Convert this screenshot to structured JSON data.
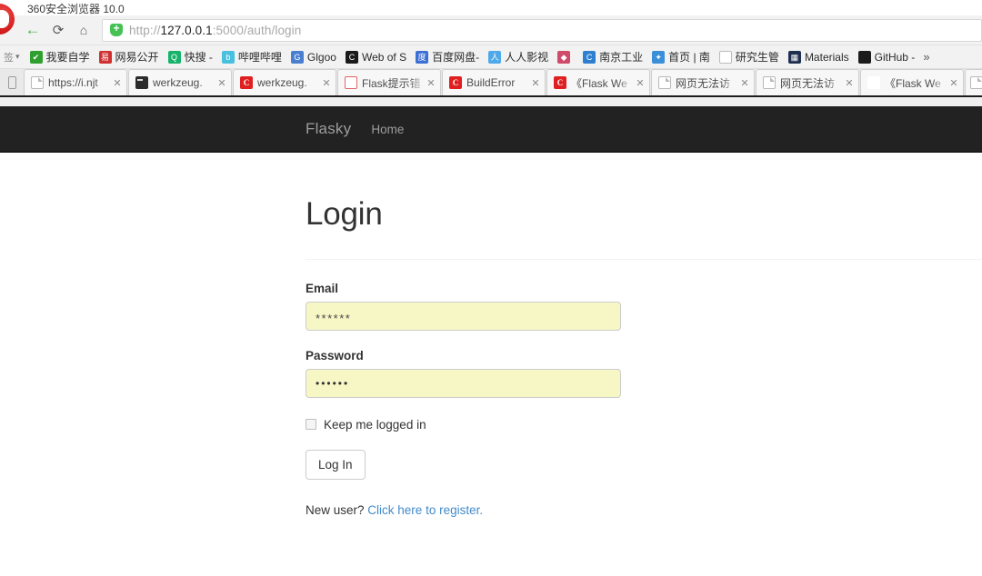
{
  "browser": {
    "window_title": "360安全浏览器 10.0",
    "nav": {
      "back_icon": "arrow-left-icon",
      "reload_icon": "reload-icon",
      "home_icon": "home-icon",
      "back_glyph": "←",
      "reload_glyph": "⟳",
      "home_glyph": "⌂"
    },
    "url": {
      "scheme": "http://",
      "host": "127.0.0.1",
      "rest": ":5000/auth/login",
      "full": "http://127.0.0.1:5000/auth/login",
      "security_icon": "shield-icon"
    },
    "bookmarks": {
      "leading": "签",
      "caret": "▾",
      "more": "»",
      "items": [
        {
          "label": "我要自学",
          "icon": "bookmark-favicon",
          "color": "#2fa02f",
          "glyph": "✔"
        },
        {
          "label": "网易公开",
          "icon": "bookmark-favicon",
          "color": "#d03030",
          "glyph": "易"
        },
        {
          "label": "快搜 -",
          "icon": "bookmark-favicon",
          "color": "#17b36b",
          "glyph": "Q"
        },
        {
          "label": "哔哩哔哩",
          "icon": "bookmark-favicon",
          "color": "#49c0e0",
          "glyph": "b"
        },
        {
          "label": "Glgoo",
          "icon": "bookmark-favicon",
          "color": "#4a7fd0",
          "glyph": "G"
        },
        {
          "label": "Web of S",
          "icon": "bookmark-favicon",
          "color": "#1a1a1a",
          "glyph": "C"
        },
        {
          "label": "百度网盘-",
          "icon": "bookmark-favicon",
          "color": "#3b6fd4",
          "glyph": "度"
        },
        {
          "label": "人人影视",
          "icon": "bookmark-favicon",
          "color": "#4fa8e8",
          "glyph": "人"
        },
        {
          "label": "",
          "icon": "bookmark-favicon",
          "color": "#d04a6a",
          "glyph": "◆"
        },
        {
          "label": "南京工业",
          "icon": "bookmark-favicon",
          "color": "#2f7fd0",
          "glyph": "C"
        },
        {
          "label": "首页 | 南",
          "icon": "bookmark-favicon",
          "color": "#3b8fd9",
          "glyph": "✦"
        },
        {
          "label": "研究生管",
          "icon": "bookmark-favicon",
          "color": "#ffffff",
          "glyph": ""
        },
        {
          "label": "Materials",
          "icon": "bookmark-favicon",
          "color": "#1f2f4f",
          "glyph": "▦"
        },
        {
          "label": "GitHub -",
          "icon": "bookmark-favicon",
          "color": "#1b1b1b",
          "glyph": ""
        }
      ]
    },
    "tabs": [
      {
        "title": "https://i.njt",
        "favicon": "doc",
        "glyph": "",
        "close": "✕"
      },
      {
        "title": "werkzeug.",
        "favicon": "term",
        "glyph": "",
        "close": "✕"
      },
      {
        "title": "werkzeug.",
        "favicon": "c",
        "glyph": "C",
        "close": "✕"
      },
      {
        "title": "Flask提示错",
        "favicon": "jian",
        "glyph": "简",
        "close": "✕"
      },
      {
        "title": "BuildError",
        "favicon": "c",
        "glyph": "C",
        "close": "✕"
      },
      {
        "title": "《Flask We",
        "favicon": "c",
        "glyph": "C",
        "close": "✕"
      },
      {
        "title": "网页无法访",
        "favicon": "doc",
        "glyph": "",
        "close": "✕"
      },
      {
        "title": "网页无法访",
        "favicon": "doc",
        "glyph": "",
        "close": "✕"
      },
      {
        "title": "《Flask We",
        "favicon": "script",
        "glyph": "ᛩ",
        "close": "✕"
      }
    ],
    "new_tab_glyph": "",
    "sidebar_toggle_icon": "mobile-view-icon"
  },
  "site": {
    "brand": "Flasky",
    "nav_links": [
      {
        "label": "Home"
      }
    ],
    "navbar_color": "#222222"
  },
  "login": {
    "heading": "Login",
    "email": {
      "label": "Email",
      "value": "******",
      "placeholder": ""
    },
    "password": {
      "label": "Password",
      "value": "••••••",
      "placeholder": ""
    },
    "remember": {
      "label": "Keep me logged in",
      "checked": false
    },
    "submit_label": "Log In",
    "register_prefix": "New user?",
    "register_link": "Click here to register.",
    "link_color": "#428bca",
    "input_bg": "#f7f7c6"
  }
}
